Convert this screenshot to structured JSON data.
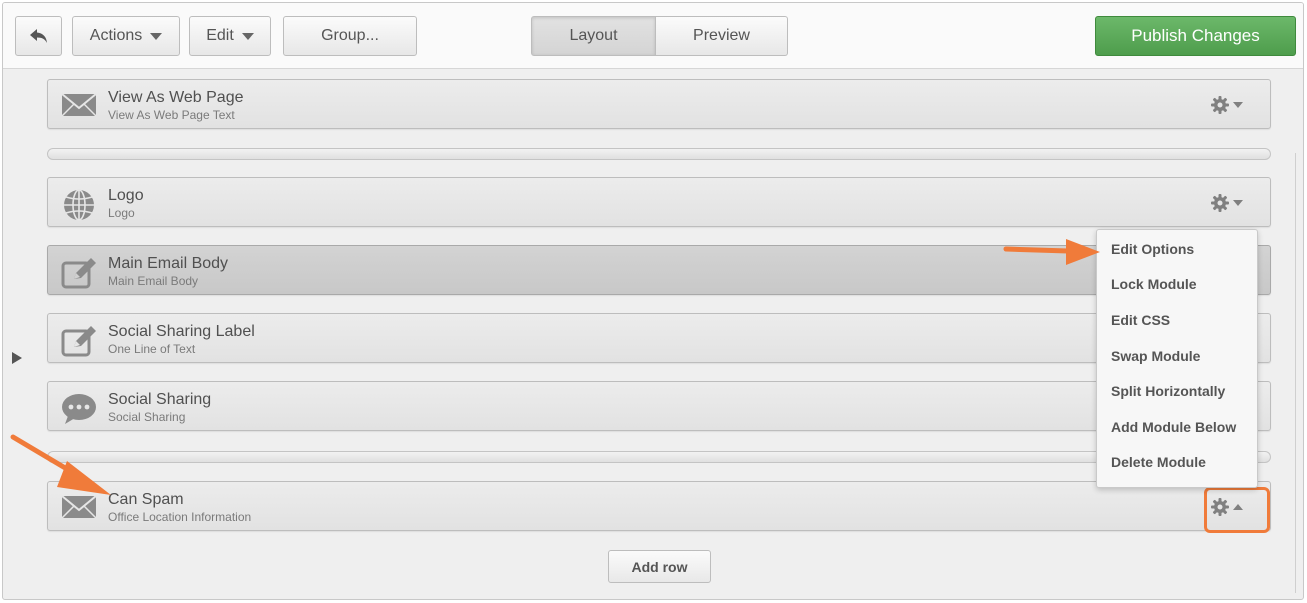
{
  "toolbar": {
    "back_label": "",
    "actions_label": "Actions",
    "edit_label": "Edit",
    "group_label": "Group...",
    "layout_label": "Layout",
    "preview_label": "Preview",
    "publish_label": "Publish Changes"
  },
  "modules": [
    {
      "title": "View As Web Page",
      "subtitle": "View As Web Page Text",
      "icon": "envelope-icon"
    },
    {
      "title": "Logo",
      "subtitle": "Logo",
      "icon": "globe-icon"
    },
    {
      "title": "Main Email Body",
      "subtitle": "Main Email Body",
      "icon": "edit-icon"
    },
    {
      "title": "Social Sharing Label",
      "subtitle": "One Line of Text",
      "icon": "edit-icon"
    },
    {
      "title": "Social Sharing",
      "subtitle": "Social Sharing",
      "icon": "chat-bubble-icon"
    },
    {
      "title": "Can Spam",
      "subtitle": "Office Location Information",
      "icon": "envelope-icon"
    }
  ],
  "context_menu": {
    "items": [
      "Edit Options",
      "Lock Module",
      "Edit CSS",
      "Swap Module",
      "Split Horizontally",
      "Add Module Below",
      "Delete Module"
    ]
  },
  "add_row_label": "Add row",
  "colors": {
    "publish": "#5aa858",
    "annotation_arrow": "#f07b3a",
    "icon_gray": "#8a8a8a"
  }
}
